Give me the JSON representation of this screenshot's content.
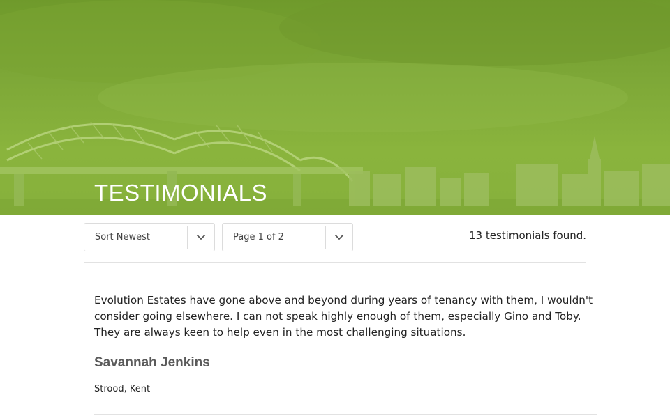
{
  "hero": {
    "title": "TESTIMONIALS",
    "overlay_color": "#8ab43d"
  },
  "filters": {
    "sort": {
      "selected": "Sort Newest"
    },
    "page": {
      "selected": "Page 1 of 2"
    },
    "chevron_icon": "chevron-down-icon"
  },
  "results": {
    "count_text": "13 testimonials found."
  },
  "testimonials": [
    {
      "quote": "Evolution Estates have gone above and beyond during years of tenancy with them, I wouldn't consider going elsewhere. I can not speak highly enough of them, especially Gino and Toby. They are always keen to help even in the most challenging situations.",
      "author": "Savannah Jenkins",
      "location": "Strood, Kent"
    }
  ]
}
